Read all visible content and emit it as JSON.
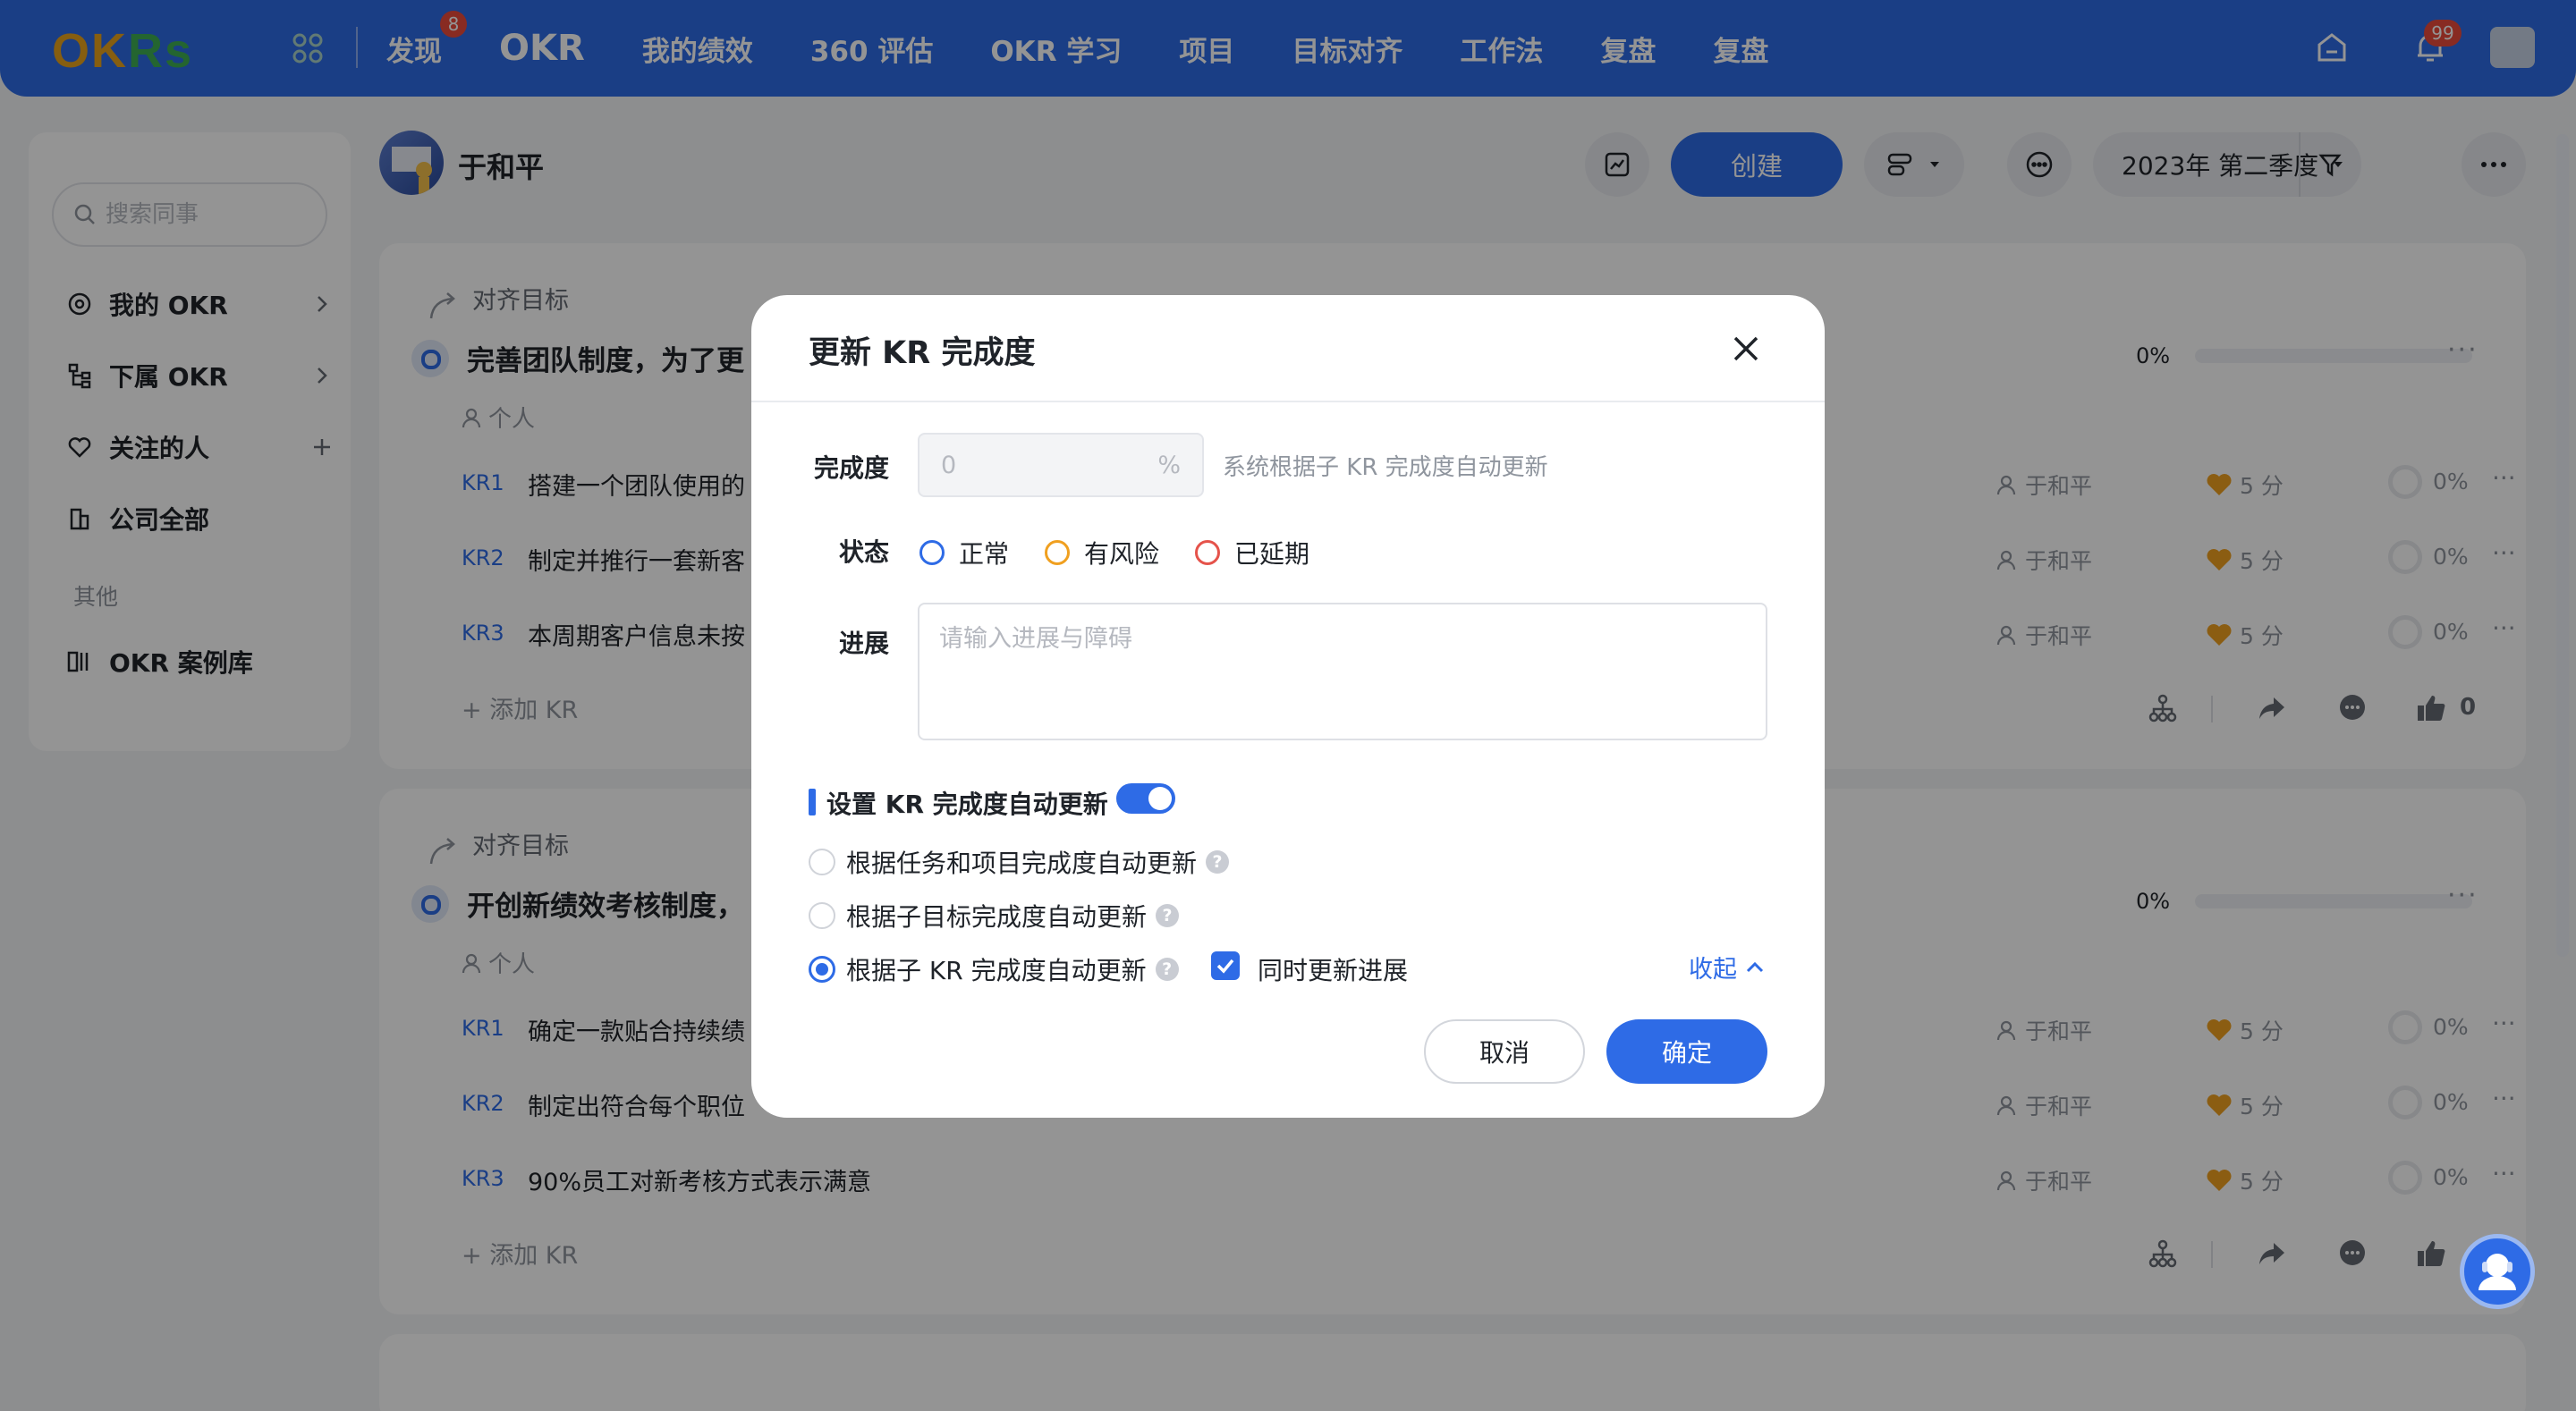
{
  "topnav": {
    "logo": "OKRs",
    "items": [
      {
        "label": "发现",
        "badge": "8"
      },
      {
        "label": "OKR",
        "active": true
      },
      {
        "label": "我的绩效"
      },
      {
        "label": "360 评估"
      },
      {
        "label": "OKR 学习"
      },
      {
        "label": "项目"
      },
      {
        "label": "目标对齐"
      },
      {
        "label": "工作法"
      },
      {
        "label": "复盘"
      },
      {
        "label": "复盘"
      }
    ],
    "notification_badge": "99"
  },
  "sidebar": {
    "search_placeholder": "搜索同事",
    "items": [
      {
        "label": "我的 OKR",
        "icon": "target-icon"
      },
      {
        "label": "下属 OKR",
        "icon": "org-icon"
      },
      {
        "label": "关注的人",
        "icon": "heart-icon"
      },
      {
        "label": "公司全部",
        "icon": "building-icon"
      }
    ],
    "group_label": "其他",
    "case_library": "OKR 案例库"
  },
  "header": {
    "user_name": "于和平",
    "create_label": "创建",
    "quarter": "2023年 第二季度"
  },
  "cards": [
    {
      "align_label": "对齐目标",
      "objective": "完善团队制度，为了更",
      "scope": "个人",
      "progress": "0%",
      "krs": [
        {
          "tag": "KR1",
          "text": "搭建一个团队使用的",
          "owner": "于和平",
          "score": "5 分",
          "pct": "0%"
        },
        {
          "tag": "KR2",
          "text": "制定并推行一套新客",
          "owner": "于和平",
          "score": "5 分",
          "pct": "0%"
        },
        {
          "tag": "KR3",
          "text": "本周期客户信息未按",
          "owner": "于和平",
          "score": "5 分",
          "pct": "0%"
        }
      ],
      "add_kr": "添加 KR",
      "likes": "0"
    },
    {
      "align_label": "对齐目标",
      "objective": "开创新绩效考核制度，",
      "scope": "个人",
      "progress": "0%",
      "krs": [
        {
          "tag": "KR1",
          "text": "确定一款贴合持续绩",
          "owner": "于和平",
          "score": "5 分",
          "pct": "0%"
        },
        {
          "tag": "KR2",
          "text": "制定出符合每个职位",
          "owner": "于和平",
          "score": "5 分",
          "pct": "0%"
        },
        {
          "tag": "KR3",
          "text": "90%员工对新考核方式表示满意",
          "owner": "于和平",
          "score": "5 分",
          "pct": "0%"
        }
      ],
      "add_kr": "添加 KR"
    }
  ],
  "modal": {
    "title": "更新 KR 完成度",
    "completion_label": "完成度",
    "completion_placeholder": "0",
    "completion_unit": "%",
    "completion_hint": "系统根据子 KR 完成度自动更新",
    "status_label": "状态",
    "status_options": [
      {
        "label": "正常",
        "color": "#2e6be6"
      },
      {
        "label": "有风险",
        "color": "#f0a020"
      },
      {
        "label": "已延期",
        "color": "#e5534b"
      }
    ],
    "progress_label": "进展",
    "progress_placeholder": "请输入进展与障碍",
    "auto_section_title": "设置 KR 完成度自动更新",
    "auto_options": [
      "根据任务和项目完成度自动更新",
      "根据子目标完成度自动更新",
      "根据子 KR 完成度自动更新"
    ],
    "auto_selected_index": 2,
    "sync_progress_label": "同时更新进展",
    "collapse_label": "收起",
    "cancel_label": "取消",
    "confirm_label": "确定"
  }
}
